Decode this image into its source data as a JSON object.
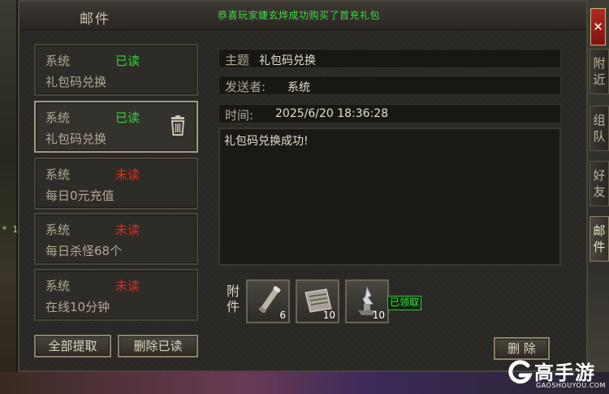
{
  "window": {
    "title": "邮件",
    "announcement": "恭喜玩家婕玄烨成功购买了首充礼包",
    "close_label": "✕"
  },
  "side_tabs": [
    {
      "label": "附近",
      "active": false
    },
    {
      "label": "组队",
      "active": false
    },
    {
      "label": "好友",
      "active": false
    },
    {
      "label": "邮件",
      "active": true
    }
  ],
  "mails": [
    {
      "sender": "系统",
      "status": "已读",
      "read": true,
      "subject": "礼包码兑换"
    },
    {
      "sender": "系统",
      "status": "已读",
      "read": true,
      "subject": "礼包码兑换",
      "selected": true
    },
    {
      "sender": "系统",
      "status": "未读",
      "read": false,
      "subject": "每日0元充值"
    },
    {
      "sender": "系统",
      "status": "未读",
      "read": false,
      "subject": "每日杀怪68个"
    },
    {
      "sender": "系统",
      "status": "未读",
      "read": false,
      "subject": "在线10分钟"
    }
  ],
  "buttons": {
    "claim_all": "全部提取",
    "delete_read": "删除已读",
    "delete": "删 除"
  },
  "detail": {
    "subject_label": "主题",
    "subject_value": "礼包码兑换",
    "sender_label": "发送者:",
    "sender_value": "系统",
    "time_label": "时间:",
    "time_value": "2025/6/20 18:36:28",
    "content": "礼包码兑换成功!"
  },
  "attachments": {
    "label": "附件",
    "items": [
      {
        "icon": "scroll-icon",
        "count": "6"
      },
      {
        "icon": "scroll-map-icon",
        "count": "10"
      },
      {
        "icon": "crystal-icon",
        "count": "10"
      }
    ],
    "claimed_label": "已领取"
  },
  "watermark": {
    "text": "高手游",
    "sub": "GAOSHOUYOU.COM"
  },
  "misc": {
    "left_glow": "* 1"
  },
  "colors": {
    "read": "#39d13f",
    "unread": "#e22b22",
    "announcement": "#42d84a"
  }
}
